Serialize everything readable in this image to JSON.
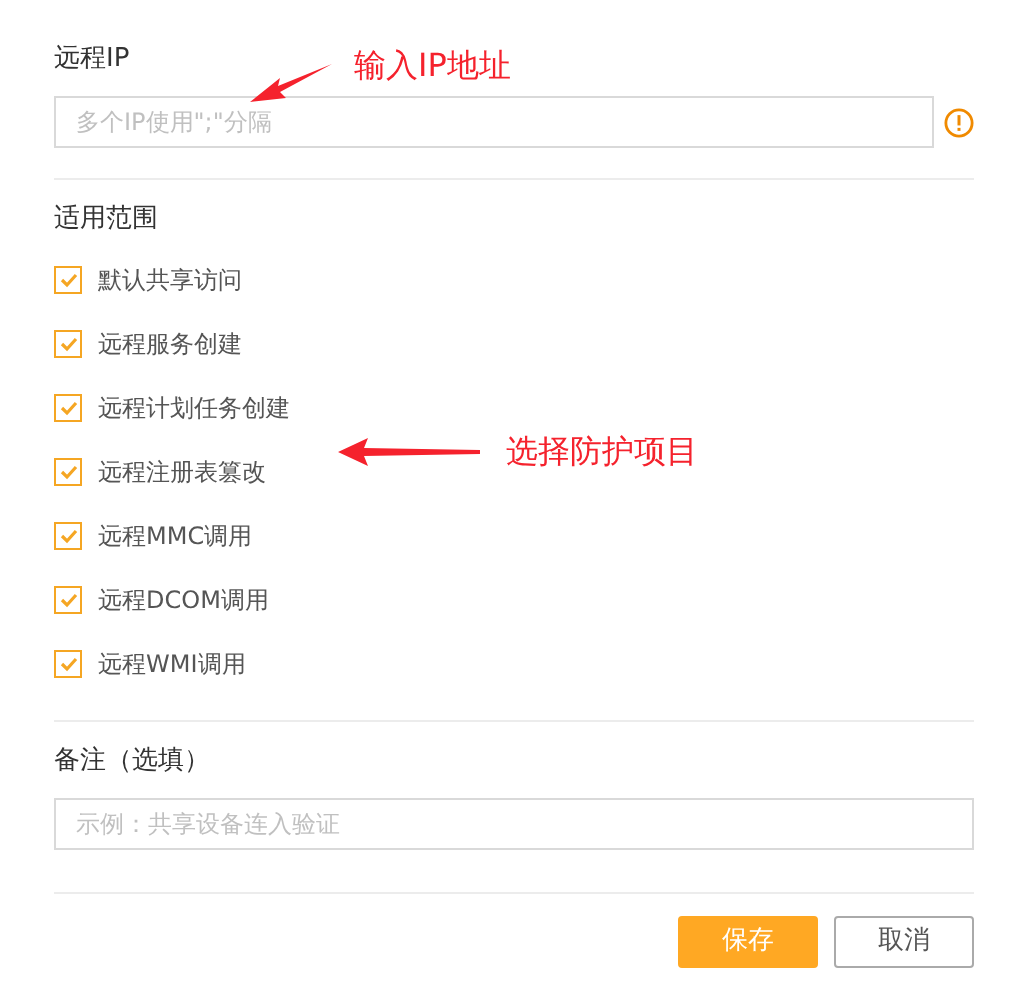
{
  "remote_ip": {
    "label": "远程IP",
    "placeholder": "多个IP使用\";\"分隔"
  },
  "scope": {
    "label": "适用范围",
    "items": [
      {
        "label": "默认共享访问",
        "checked": true
      },
      {
        "label": "远程服务创建",
        "checked": true
      },
      {
        "label": "远程计划任务创建",
        "checked": true
      },
      {
        "label": "远程注册表篡改",
        "checked": true
      },
      {
        "label": "远程MMC调用",
        "checked": true
      },
      {
        "label": "远程DCOM调用",
        "checked": true
      },
      {
        "label": "远程WMI调用",
        "checked": true
      }
    ]
  },
  "note": {
    "label": "备注（选填）",
    "placeholder": "示例：共享设备连入验证"
  },
  "buttons": [
    {
      "label": "保存",
      "kind": "primary"
    },
    {
      "label": "取消",
      "kind": "secondary"
    }
  ],
  "annotations": [
    {
      "text": "输入IP地址"
    },
    {
      "text": "选择防护项目"
    }
  ]
}
